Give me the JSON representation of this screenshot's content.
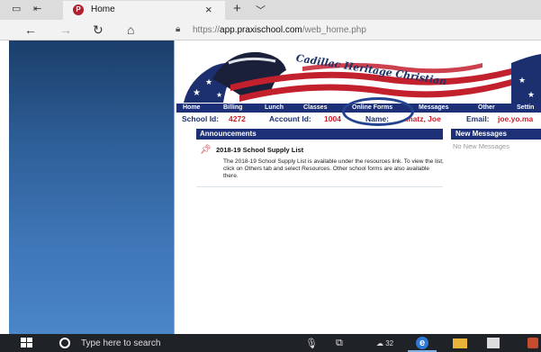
{
  "browser": {
    "tab_title": "Home",
    "favicon_letter": "P",
    "url_scheme": "https://",
    "url_host": "app.praxischool.com",
    "url_path": "/web_home.php"
  },
  "site": {
    "banner_title": "Cadillac Heritage Christian",
    "menu": [
      "Home",
      "Billing",
      "Lunch",
      "Classes",
      "Online Forms",
      "Messages",
      "Other",
      "Settin"
    ],
    "school_id_label": "School Id:",
    "school_id": "4272",
    "account_id_label": "Account Id:",
    "account_id": "1004",
    "name_label": "Name:",
    "name_value": "...matz, Joe",
    "email_label": "Email:",
    "email_value": "joe.yo.ma"
  },
  "announcements": {
    "header": "Announcements",
    "items": [
      {
        "title": "2018-19 School Supply List",
        "body": "The 2018-19 School Supply List is available under the resources link. To view the list, click on Others tab and select Resources. Other school forms are also available there."
      }
    ]
  },
  "messages": {
    "header": "New Messages",
    "empty_text": "No New Messages"
  },
  "taskbar": {
    "search_placeholder": "Type here to search",
    "badge": "32"
  },
  "colors": {
    "navy": "#1c2f77",
    "accent_red": "#cc1f2b",
    "sidebar_top": "#1b3e6a",
    "sidebar_bottom": "#4a86c8",
    "highlight": "#24448f"
  }
}
